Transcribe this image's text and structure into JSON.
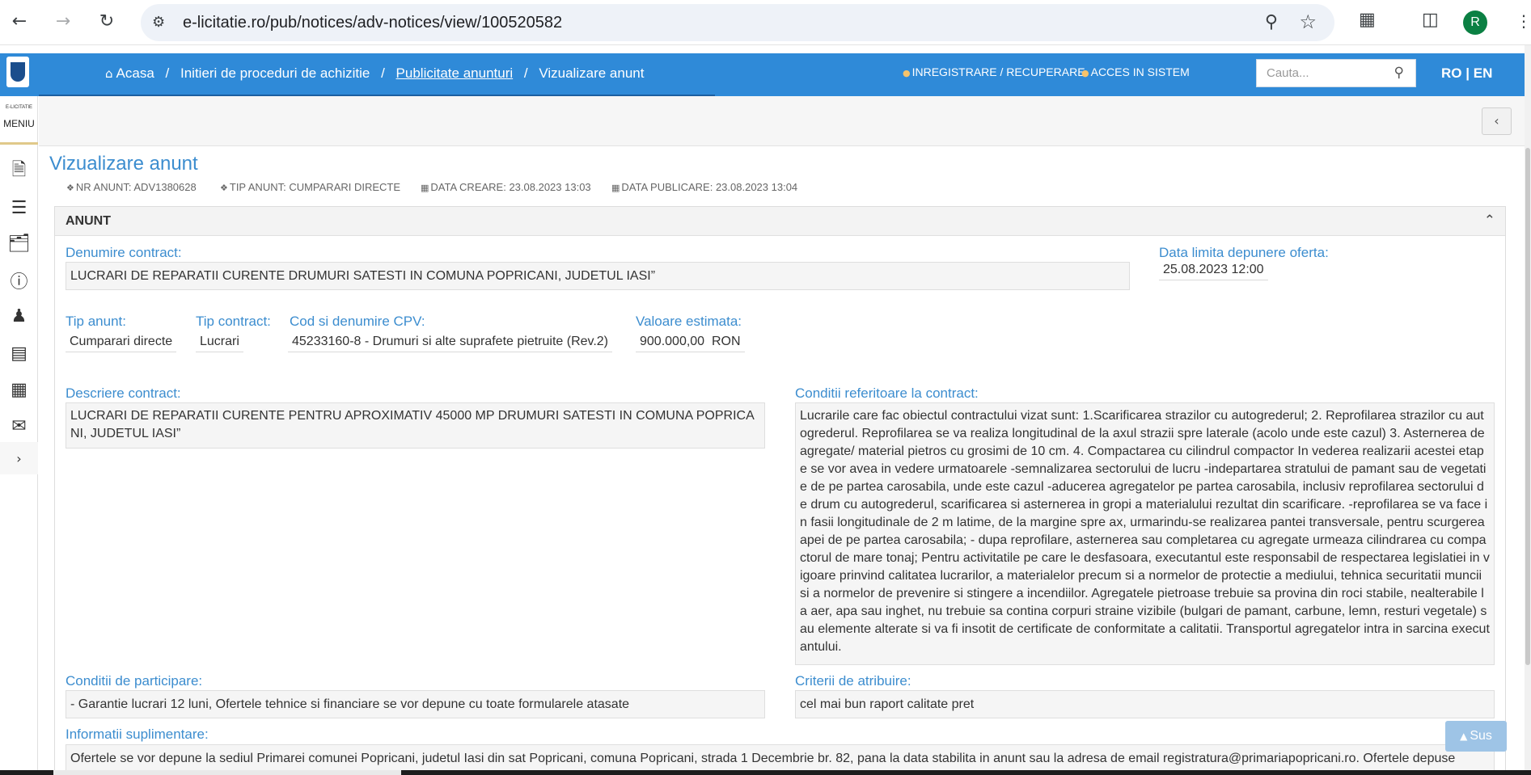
{
  "browser": {
    "url": "e-licitatie.ro/pub/notices/adv-notices/view/100520582",
    "profile_initial": "R"
  },
  "header": {
    "breadcrumb": {
      "home": "Acasa",
      "item2": "Initieri de proceduri de achizitie",
      "item3": "Publicitate anunturi",
      "item4": "Vizualizare anunt",
      "separator": "/"
    },
    "register_label": "INREGISTRARE / RECUPERARE",
    "login_label": "ACCES IN SISTEM",
    "search_placeholder": "Cauta...",
    "lang_ro": "RO",
    "lang_sep": "|",
    "lang_en": "EN"
  },
  "sidebar": {
    "brand_small": "E-LICITATIE",
    "menu_label": "MENIU"
  },
  "page": {
    "title": "Vizualizare anunt",
    "meta": {
      "nr_anunt": "NR ANUNT: ADV1380628",
      "tip_anunt": "TIP ANUNT: CUMPARARI DIRECTE",
      "data_creare": "DATA CREARE: 23.08.2023 13:03",
      "data_publicare": "DATA PUBLICARE: 23.08.2023 13:04"
    }
  },
  "panel": {
    "title": "ANUNT",
    "denumire_contract": {
      "label": "Denumire contract:",
      "value": "LUCRARI DE REPARATII CURENTE DRUMURI SATESTI IN COMUNA POPRICANI, JUDETUL IASI”"
    },
    "data_limita": {
      "label": "Data limita depunere oferta:",
      "value": "25.08.2023 12:00"
    },
    "tip_anunt": {
      "label": "Tip anunt:",
      "value": "Cumparari directe"
    },
    "tip_contract": {
      "label": "Tip contract:",
      "value": "Lucrari"
    },
    "cpv": {
      "label": "Cod si denumire CPV:",
      "value": "45233160-8 - Drumuri si alte suprafete pietruite (Rev.2)"
    },
    "valoare": {
      "label": "Valoare estimata:",
      "value": "900.000,00  RON"
    },
    "descriere": {
      "label": "Descriere contract:",
      "value": "LUCRARI DE REPARATII CURENTE PENTRU APROXIMATIV 45000 MP DRUMURI SATESTI IN COMUNA POPRICANI, JUDETUL IASI”"
    },
    "conditii_contract": {
      "label": "Conditii referitoare la contract:",
      "value": "Lucrarile care fac obiectul contractului vizat sunt: 1.Scarificarea strazilor cu autogrederul; 2. Reprofilarea strazilor cu autogrederul. Reprofilarea se va realiza longitudinal de la axul strazii spre laterale (acolo unde este cazul) 3. Asternerea de agregate/ material pietros cu grosimi de 10 cm. 4. Compactarea cu cilindrul compactor In vederea realizarii acestei etape se vor avea in vedere urmatoarele -semnalizarea sectorului de lucru -indepartarea stratului de pamant sau de vegetatie de pe partea carosabila, unde este cazul -aducerea agregatelor pe partea carosabila, inclusiv reprofilarea sectorului de drum cu autogrederul, scarificarea si asternerea in gropi a materialului rezultat din scarificare. -reprofilarea se va face in fasii longitudinale de 2 m latime, de la margine spre ax, urmarindu-se realizarea pantei transversale, pentru scurgerea apei de pe partea carosabila; - dupa reprofilare, asternerea sau completarea cu agregate urmeaza cilindrarea cu compactorul de mare tonaj; Pentru activitatile pe care le desfasoara, executantul este responsabil de respectarea legislatiei in vigoare prinvind calitatea lucrarilor, a materialelor precum si a normelor de protectie a mediului, tehnica securitatii muncii si a normelor de prevenire si stingere a incendiilor. Agregatele pietroase trebuie sa provina din roci stabile, nealterabile la aer, apa sau inghet, nu trebuie sa contina corpuri straine vizibile (bulgari de pamant, carbune, lemn, resturi vegetale) sau elemente alterate si va fi insotit de certificate de conformitate a calitatii. Transportul agregatelor intra in sarcina executantului."
    },
    "conditii_participare": {
      "label": "Conditii de participare:",
      "value": "- Garantie lucrari 12 luni, Ofertele tehnice si financiare se vor depune cu toate formularele atasate"
    },
    "criterii": {
      "label": "Criterii de atribuire:",
      "value": "cel mai bun raport calitate pret"
    },
    "informatii": {
      "label": "Informatii suplimentare:",
      "value": "Ofertele se vor depune la sediul Primarei comunei Popricani, judetul Iasi din sat Popricani, comuna Popricani, strada 1 Decembrie br. 82, pana la data stabilita in anunt sau la adresa de email registratura@primariapopricani.ro. Ofertele depuse"
    }
  },
  "scroll_top_label": "Sus"
}
